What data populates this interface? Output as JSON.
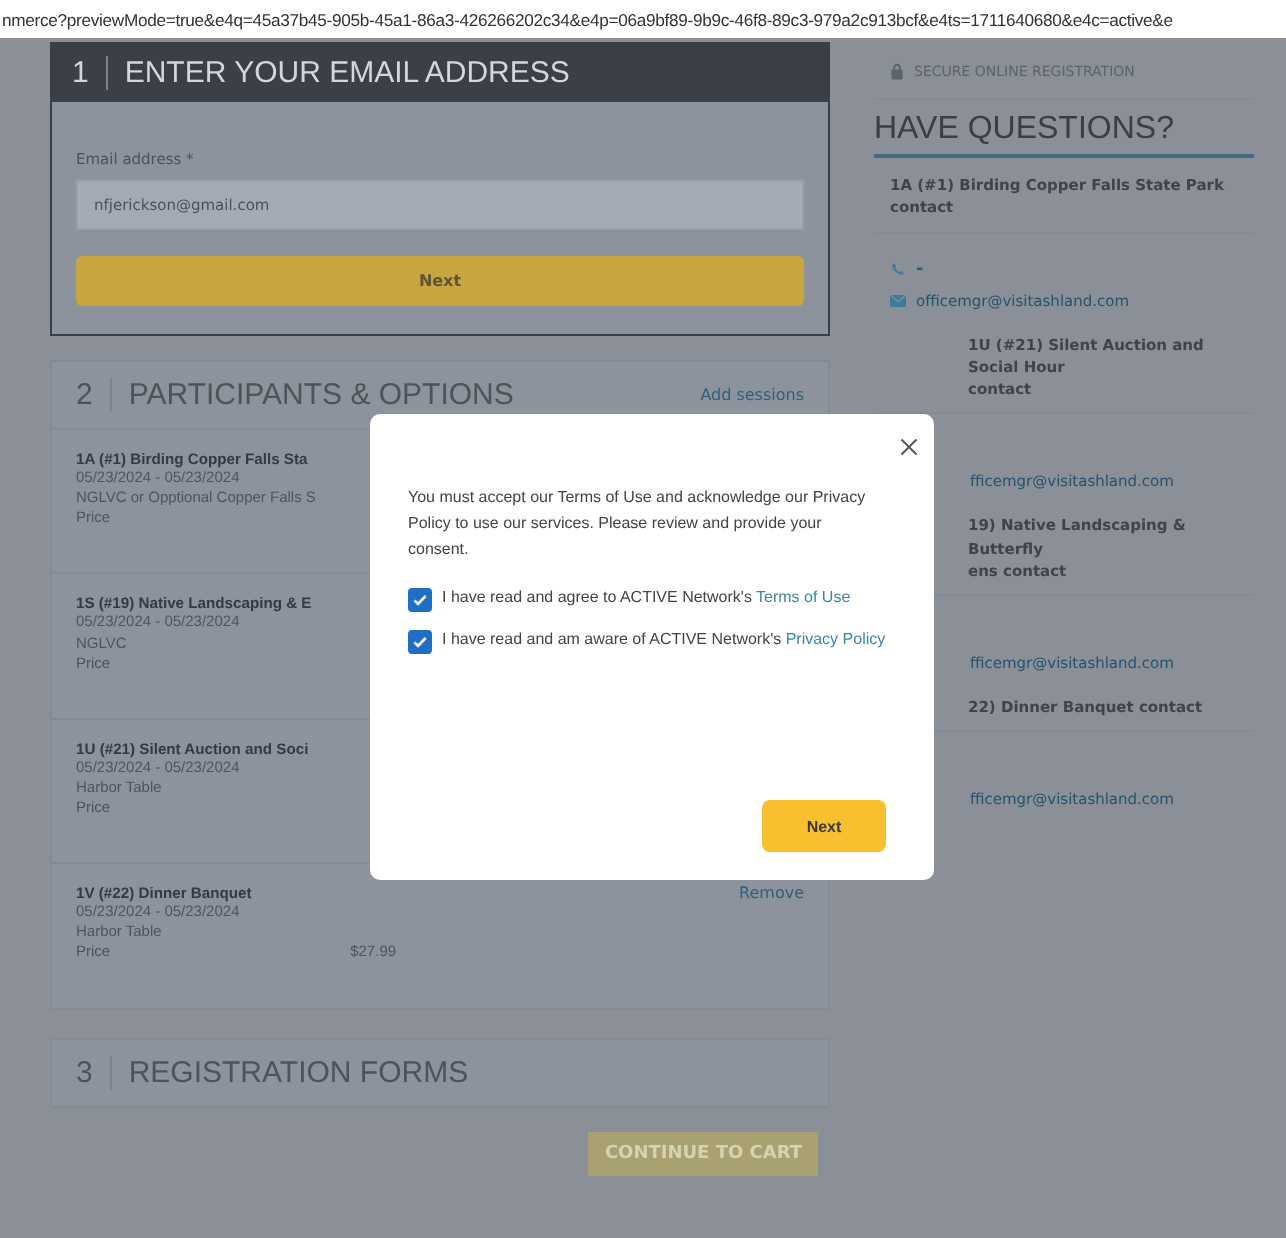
{
  "url": "nmerce?previewMode=true&e4q=45a37b45-905b-45a1-86a3-426266202c34&e4p=06a9bf89-9b9c-46f8-89c3-979a2c913bcf&e4ts=1711640680&e4c=active&e",
  "section1": {
    "number": "1",
    "title": "ENTER YOUR EMAIL ADDRESS",
    "email_label": "Email address *",
    "email_value": "nfjerickson@gmail.com",
    "next": "Next"
  },
  "section2": {
    "number": "2",
    "title": "PARTICIPANTS & OPTIONS",
    "add_link": "Add sessions",
    "items": [
      {
        "title": "1A (#1) Birding Copper Falls Sta",
        "date": "05/23/2024 - 05/23/2024",
        "detail": "NGLVC or Opptional Copper Falls S",
        "price_label": "Price"
      },
      {
        "title": "1S (#19) Native Landscaping & E",
        "date": "05/23/2024 - 05/23/2024",
        "detail": "NGLVC",
        "price_label": "Price"
      },
      {
        "title": "1U (#21) Silent Auction and Soci",
        "date": "05/23/2024 - 05/23/2024",
        "detail": "Harbor Table",
        "price_label": "Price"
      },
      {
        "title": "1V (#22) Dinner Banquet",
        "date": "05/23/2024 - 05/23/2024",
        "detail": "Harbor Table",
        "price_label": "Price",
        "price": "$27.99",
        "remove": "Remove"
      }
    ]
  },
  "section3": {
    "number": "3",
    "title": "REGISTRATION FORMS"
  },
  "continue_button": {
    "label": "CONTINUE TO CART",
    "disabled": true
  },
  "sidebar": {
    "secure": "SECURE ONLINE REGISTRATION",
    "heading": "HAVE QUESTIONS?",
    "contacts": [
      {
        "title_lines": [
          "1A (#1) Birding Copper Falls State Park",
          "contact"
        ],
        "phone": "-",
        "email": "officemgr@visitashland.com",
        "cut": false
      },
      {
        "title_lines": [
          "1U (#21) Silent Auction and Social Hour",
          "contact"
        ],
        "email": "fficemgr@visitashland.com",
        "cut": true
      },
      {
        "title_lines": [
          "19) Native Landscaping & Butterfly",
          "ens contact"
        ],
        "email": "fficemgr@visitashland.com",
        "cut": true
      },
      {
        "title_lines": [
          "22) Dinner Banquet contact"
        ],
        "email": "fficemgr@visitashland.com",
        "cut": true
      }
    ]
  },
  "modal": {
    "message": "You must accept our Terms of Use and acknowledge our Privacy Policy to use our services. Please review and provide your consent.",
    "checks": [
      {
        "label": "I have read and agree to ACTIVE Network's",
        "link": "Terms of Use",
        "checked": true
      },
      {
        "label": "I have read and am aware of ACTIVE Network's",
        "link": "Privacy Policy",
        "checked": true
      }
    ],
    "next": "Next"
  }
}
